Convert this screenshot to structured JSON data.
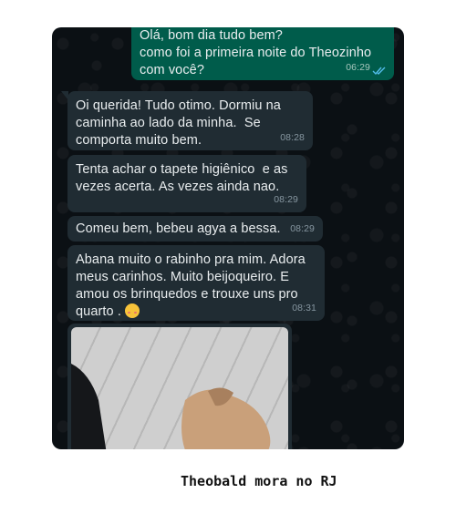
{
  "messages": [
    {
      "dir": "out",
      "text": "Olá, bom dia tudo bem?\ncomo foi a primeira noite do Theozinho\ncom você?",
      "time": "06:29"
    },
    {
      "dir": "in",
      "text": "Oi querida! Tudo otimo. Dormiu na\ncaminha ao lado da minha.  Se\ncomporta muito bem.",
      "time": "08:28"
    },
    {
      "dir": "in",
      "text": "Tenta achar o tapete higiênico  e as\nvezes acerta. As vezes ainda nao.",
      "time": "08:29"
    },
    {
      "dir": "in",
      "text": "Comeu bem, bebeu agya a bessa.",
      "time": "08:29"
    },
    {
      "dir": "in",
      "text": "Abana muito o rabinho pra mim. Adora\nmeus carinhos. Muito beijoqueiro. E\namou os brinquedos e trouxe uns pro\nquarto . ",
      "time": "08:31",
      "emoji": "smiling-face-with-hearts-emoji"
    }
  ],
  "caption": "Theobald mora no RJ",
  "colors": {
    "chat_background": "#0b1014",
    "outgoing_bubble": "#005c4b",
    "incoming_bubble": "#202c33",
    "read_ticks": "#53bdeb"
  }
}
